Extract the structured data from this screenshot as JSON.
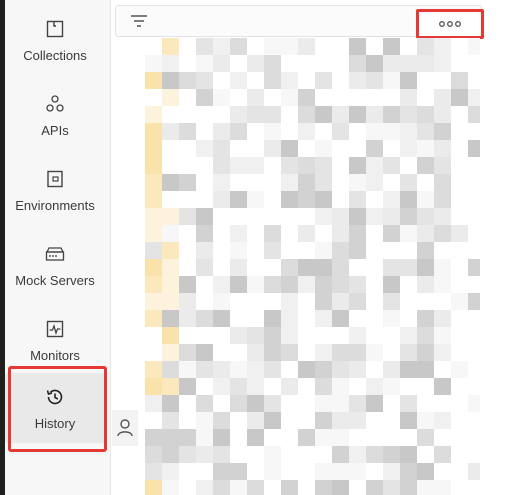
{
  "sidebar": {
    "items": [
      {
        "label": "Collections",
        "icon": "collections-icon"
      },
      {
        "label": "APIs",
        "icon": "apis-icon"
      },
      {
        "label": "Environments",
        "icon": "environments-icon"
      },
      {
        "label": "Mock Servers",
        "icon": "mock-servers-icon"
      },
      {
        "label": "Monitors",
        "icon": "monitors-icon"
      },
      {
        "label": "History",
        "icon": "history-icon",
        "active": true
      }
    ]
  },
  "toolbar": {
    "filter_icon": "filter-icon",
    "more_icon": "more-options-icon"
  },
  "colors": {
    "highlight": "#e53935",
    "sidebar_bg": "#f7f7f7",
    "pixel_yellow": "#fbe7b5"
  }
}
